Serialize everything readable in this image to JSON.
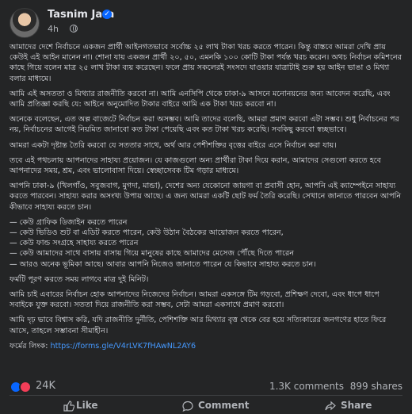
{
  "post": {
    "author": "Tasnim Jara",
    "time": "4h",
    "paragraphs": [
      "আমাদের দেশে নির্বাচনে একজন প্রার্থী আইনগতভাবে সর্বোচ্চ ২৫ লাখ টাকা খরচ করতে পারেন। কিন্তু বাস্তবে আমরা দেখি প্রায় কেউই এই আইন মানেন না। শোনা যায় একজন প্রার্থী ২০, ৫০, এমনকি ১০০ কোটি টাকা পর্যন্ত খরচ করেন। অথচ নির্বাচন কমিশনের কাছে গিয়ে বলেন মাত্র ২৫ লাখ টাকা ব্যয় করেছেন। ফলে প্রায় সকলেরই সংসদে যাওয়ার যাত্রাটাই শুরু হয় আইন ভাঙা ও মিথ্যা বলার মাধ্যমে।",
      "আমি এই অসততা ও মিথ্যার রাজনীতি করবো না। আমি এনসিপি থেকে ঢাকা-৯ আসনে মনোনয়নের জন্য আবেদন করেছি, এবং আমি প্রতিজ্ঞা করছি যে: আইনে অনুমোদিত টাকার বাইরে আমি এক টাকা খরচ করবো না।",
      "অনেকে বলেছেন, এত অল্প বাজেটে নির্বাচন করা অসম্ভব। আমি তাদের বলেছি, আমরা প্রমাণ করবো এটা সম্ভব। শুধু নির্বাচনের পর নয়, নির্বাচনের আগেই নিয়মিত জানাবো কত টাকা পেয়েছি এবং কত টাকা খরচ করেছি। সবকিছু করবো স্বচ্ছভাবে।",
      "আমরা একটা দৃষ্টান্ত তৈরি করবো যে সততার সাথে, অর্থ আর পেশীশক্তির বৃত্তের বাইরে এসে নির্বাচন করা যায়।",
      "তবে এই পথচলায় আপনাদের সাহায্য প্রয়োজন। যে কাজগুলো অন্য প্রার্থীরা টাকা দিয়ে করান, আমাদের সেগুলো করতে হবে আপনাদের সময়, শ্রম, এবং ভালোবাসা দিয়ে। স্বেচ্ছাসেবক টিম গড়ার মাধ্যমে।",
      "আপনি ঢাকা-৯ (খিলগাঁও, সবুজবাগ, মুগদা, মান্ডা), দেশের অন্য যেকোনো জায়গা বা প্রবাসী হোন, আপনি এই ক্যাম্পেইনে সাহায্য করতে পারবেন। সাহায্য করার অসংখ্য উপায় আছে। এ জন্য আমরা একটি ছোট ফর্ম তৈরি করেছি। সেখানে জানাতে পারবেন আপনি কীভাবে সাহায্য করতে চান।"
    ],
    "list": [
      "— কেউ গ্রাফিক ডিজাইন করতে পারেন",
      "— কেউ ভিডিও শুট বা এডিট করতে পারেন, কেউ উঠান বৈঠকের আয়োজন করতে পারেন,",
      "— কেউ ফান্ড সংগ্রহে সাহায্য করতে পারেন",
      "— কেউ আমাদের সাথে বাসায় বাসায় গিয়ে মানুষের কাছে আমাদের মেসেজ পৌঁছে দিতে পারেন",
      "— আরও অনেক ভূমিকা আছে। আবার আপনি নিজেও জানাতে পারেন যে কিভাবে সাহায্য করতে চান।"
    ],
    "paragraphs2": [
      "ফর্মটি পূরণ করতে সময় লাগবে মাত্র দুই মিনিট।",
      "আমি চাই এবারের নির্বাচন হোক আপনাদের নিজেদের নির্বাচন। আমরা একসঙ্গে টিম গড়বো, প্রশিক্ষণ দেবো, এবং ধাপে ধাপে সবাইকে যুক্ত করবো। সততা দিয়ে রাজনীতি করা সম্ভব, সেটা আমরা একসাথে প্রমাণ করবো।",
      "আমি দৃঢ় ভাবে বিশ্বাস করি, যদি রাজনীতি দুর্নীতি, পেশিশক্তি আর মিথ্যার বৃত্ত থেকে বের হয়ে সত্যিকারের জনগণের হাতে ফিরে আসে, তাহলে সম্ভাবনা সীমাহীন।"
    ],
    "form_label": "ফর্মের লিংক: ",
    "form_link": "https://forms.gle/V4rLVK7fHAwNL2AY6"
  },
  "stats": {
    "reactions": "24K",
    "comments": "1.3K comments",
    "shares": "899 shares"
  },
  "actions": {
    "like": "Like",
    "comment": "Comment",
    "share": "Share"
  },
  "colors": {
    "background": "#242526",
    "link": "#4599ff",
    "verified": "#0866ff"
  }
}
